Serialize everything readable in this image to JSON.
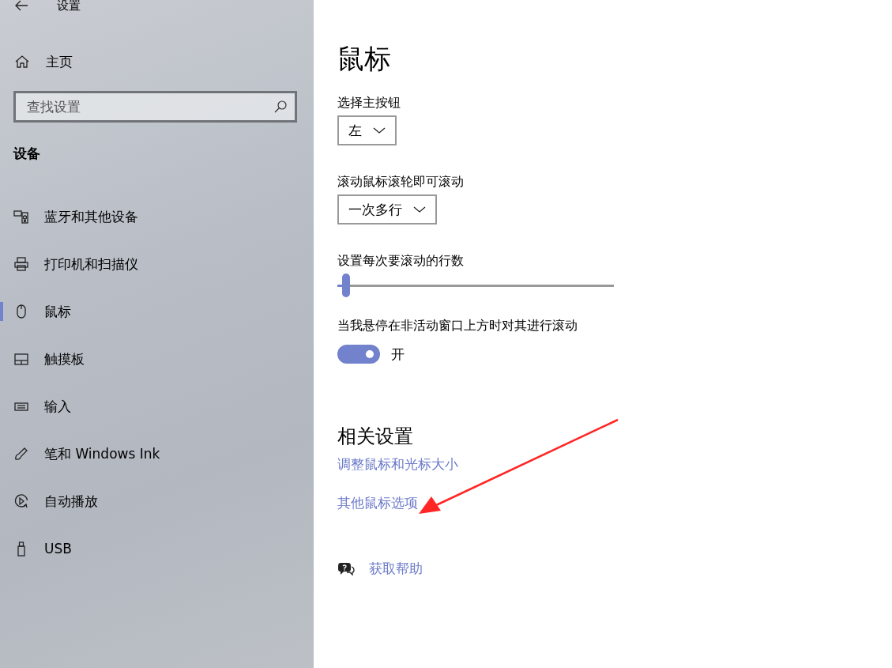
{
  "window": {
    "title": "设置"
  },
  "sidebar": {
    "home": "主页",
    "search": {
      "placeholder": "查找设置"
    },
    "section": "设备",
    "items": [
      {
        "label": "蓝牙和其他设备",
        "selected": false
      },
      {
        "label": "打印机和扫描仪",
        "selected": false
      },
      {
        "label": "鼠标",
        "selected": true
      },
      {
        "label": "触摸板",
        "selected": false
      },
      {
        "label": "输入",
        "selected": false
      },
      {
        "label": "笔和 Windows Ink",
        "selected": false
      },
      {
        "label": "自动播放",
        "selected": false
      },
      {
        "label": "USB",
        "selected": false
      }
    ]
  },
  "main": {
    "title": "鼠标",
    "settings": [
      {
        "kind": "dropdown",
        "label": "选择主按钮",
        "value": "左"
      },
      {
        "kind": "dropdown",
        "label": "滚动鼠标滚轮即可滚动",
        "value": "一次多行"
      },
      {
        "kind": "slider",
        "label": "设置每次要滚动的行数",
        "level": 0.03
      },
      {
        "kind": "toggle",
        "label": "当我悬停在非活动窗口上方时对其进行滚动",
        "on": true,
        "state_text": "开"
      }
    ],
    "related": {
      "title": "相关设置",
      "links": [
        "调整鼠标和光标大小",
        "其他鼠标选项"
      ]
    },
    "help": "获取帮助"
  },
  "annotations": [
    {
      "kind": "arrow"
    }
  ]
}
